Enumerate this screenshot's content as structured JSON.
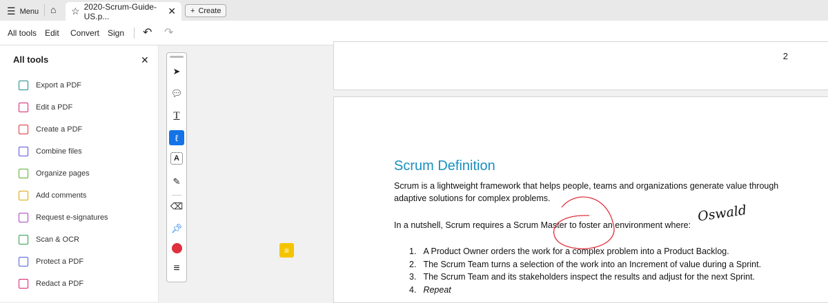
{
  "topbar": {
    "menu_label": "Menu",
    "tab_title": "2020-Scrum-Guide-US.p...",
    "create_label": "Create"
  },
  "toolbar": {
    "items": [
      "All tools",
      "Edit",
      "Convert",
      "Sign"
    ]
  },
  "sidebar": {
    "title": "All tools",
    "tools": [
      {
        "label": "Export a PDF",
        "icon": "export-pdf-icon",
        "color": "#1b8a8a"
      },
      {
        "label": "Edit a PDF",
        "icon": "edit-pdf-icon",
        "color": "#d6206f"
      },
      {
        "label": "Create a PDF",
        "icon": "create-pdf-icon",
        "color": "#e0303c"
      },
      {
        "label": "Combine files",
        "icon": "combine-files-icon",
        "color": "#5b4fd6"
      },
      {
        "label": "Organize pages",
        "icon": "organize-pages-icon",
        "color": "#5aad2e"
      },
      {
        "label": "Add comments",
        "icon": "add-comments-icon",
        "color": "#d8a800"
      },
      {
        "label": "Request e-signatures",
        "icon": "request-esignatures-icon",
        "color": "#a83fc2"
      },
      {
        "label": "Scan & OCR",
        "icon": "scan-ocr-icon",
        "color": "#2f9a4a"
      },
      {
        "label": "Protect a PDF",
        "icon": "protect-pdf-icon",
        "color": "#4d5fd9"
      },
      {
        "label": "Redact a PDF",
        "icon": "redact-pdf-icon",
        "color": "#d6206f"
      }
    ]
  },
  "document": {
    "page_number": "2",
    "heading": "Scrum Definition",
    "para1_line1": "Scrum is a lightweight framework that helps people, teams and organizations generate value through",
    "para1_line2": "adaptive solutions for complex problems.",
    "para2": "In a nutshell, Scrum requires a Scrum Master to foster an environment where:",
    "signature": "Oswald",
    "list": [
      {
        "num": "1.",
        "text": "A Product Owner orders the work for a complex problem into a Product Backlog."
      },
      {
        "num": "2.",
        "text": "The Scrum Team turns a selection of the work into an Increment of value during a Sprint."
      },
      {
        "num": "3.",
        "text": "The Scrum Team and its stakeholders inspect the results and adjust for the next Sprint."
      },
      {
        "num": "4.",
        "text": "Repeat"
      }
    ]
  },
  "colors": {
    "heading": "#1a8fc0",
    "active_tool": "#1473e6",
    "ink": "#e0303c"
  }
}
